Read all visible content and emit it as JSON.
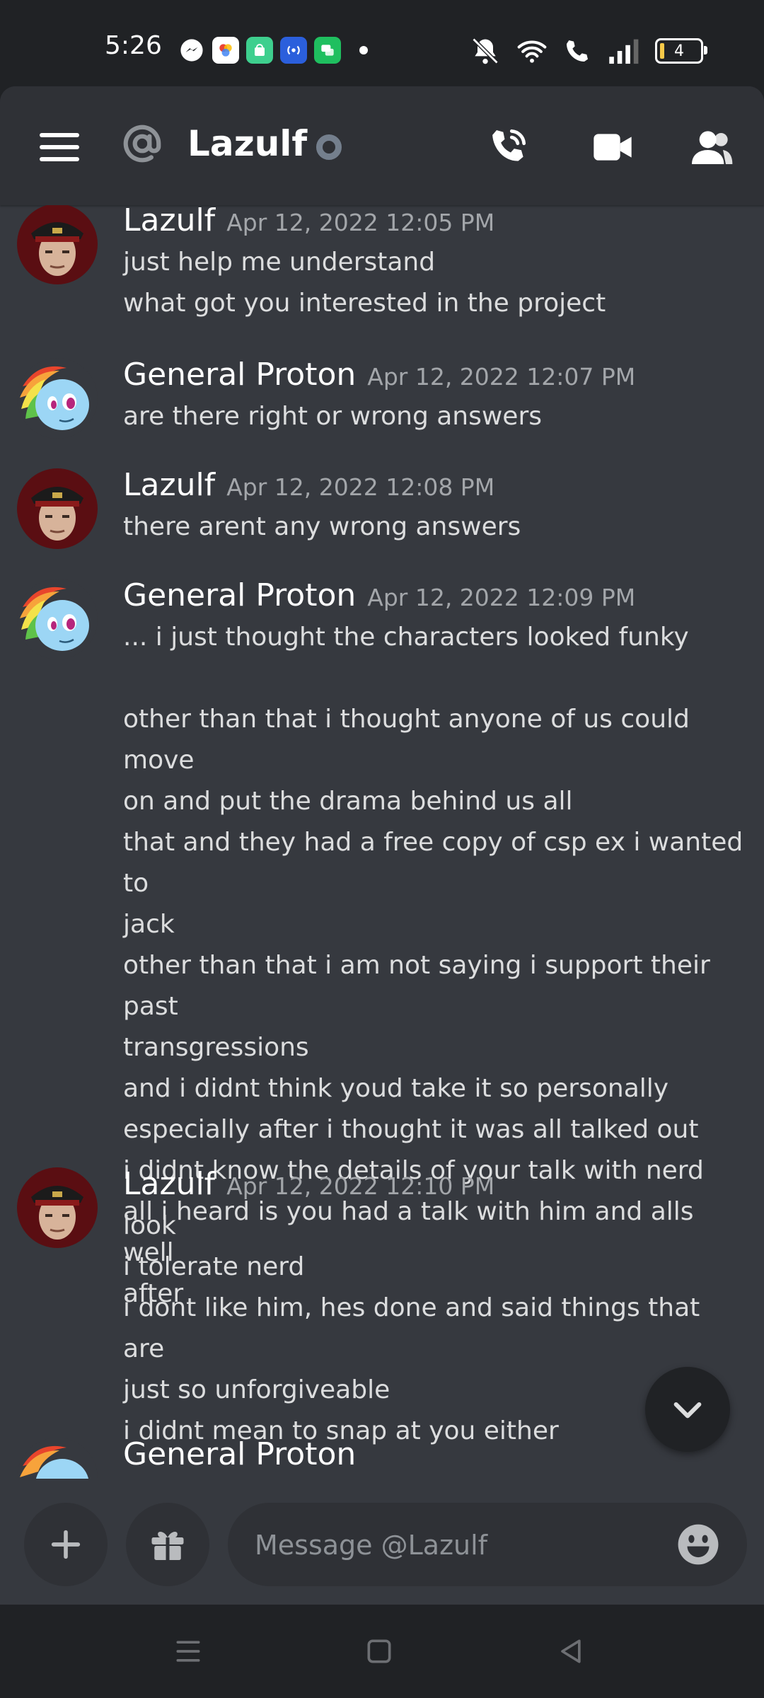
{
  "status_bar": {
    "time": "5:26",
    "battery": "4",
    "notification_icons": [
      "messenger-icon",
      "photos-icon",
      "shop-icon",
      "broadcast-icon",
      "chat-icon"
    ]
  },
  "header": {
    "channel_name": "Lazulf",
    "icons": [
      "menu-icon",
      "at-icon",
      "voice-call-icon",
      "video-call-icon",
      "members-icon"
    ]
  },
  "messages": [
    {
      "author": "Lazulf",
      "timestamp": "Apr 12, 2022 12:05 PM",
      "lines": [
        "just help me understand",
        "what got you interested in the project"
      ]
    },
    {
      "author": "General Proton",
      "timestamp": "Apr 12, 2022 12:07 PM",
      "lines": [
        "are there right or wrong answers"
      ]
    },
    {
      "author": "Lazulf",
      "timestamp": "Apr 12, 2022 12:08 PM",
      "lines": [
        "there arent any wrong answers"
      ]
    },
    {
      "author": "General Proton",
      "timestamp": "Apr 12, 2022 12:09 PM",
      "lines": [
        "... i just thought the characters looked funky",
        "",
        "other than that i thought anyone of us could move",
        "on and put the drama behind us all",
        "that and they had a free copy of csp ex i wanted to",
        "jack",
        "other than that i am not saying i support their past",
        "transgressions",
        "and i didnt think youd take it so personally",
        "especially after i thought it was all talked out",
        "i didnt know the details of your talk with nerd",
        "all i heard is you had a talk with him and alls well",
        "after"
      ]
    },
    {
      "author": "Lazulf",
      "timestamp": "Apr 12, 2022 12:10 PM",
      "lines": [
        "look",
        "i tolerate nerd",
        "i dont like him, hes done and said things that are",
        "just so unforgiveable",
        "i didnt mean to snap at you either"
      ]
    },
    {
      "author": "General Proton",
      "timestamp": "",
      "lines": []
    }
  ],
  "composer": {
    "placeholder": "Message @Lazulf"
  },
  "colors": {
    "background": "#36393f",
    "header": "#2f3136",
    "system_bar": "#202225",
    "text": "#dcddde",
    "muted": "#a3a6aa"
  }
}
